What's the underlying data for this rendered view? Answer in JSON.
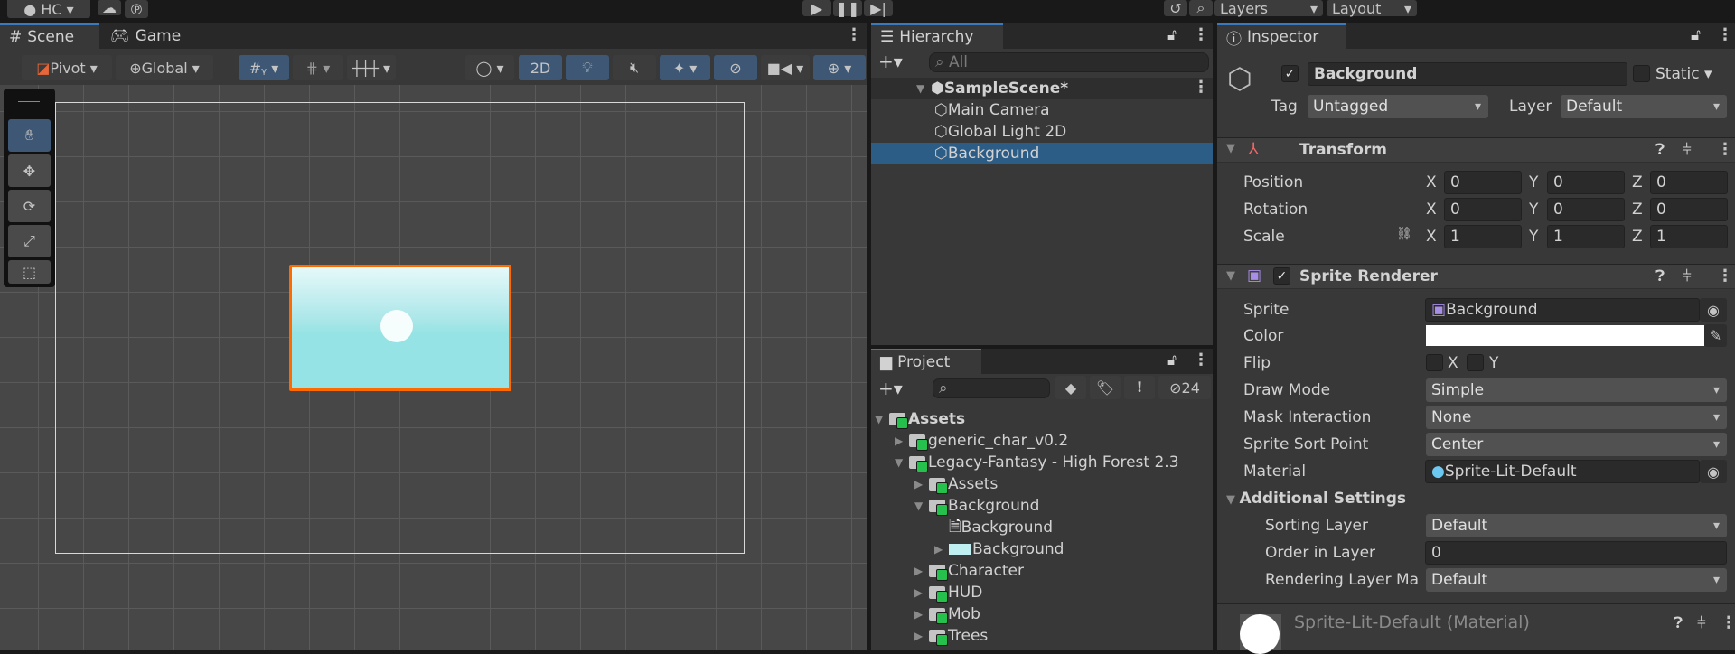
{
  "topbar": {
    "account": "HC",
    "play_icons": [
      "play-icon",
      "pause-icon",
      "step-icon"
    ],
    "layers": "Layers",
    "layout": "Layout"
  },
  "scene": {
    "tabs": [
      {
        "label": "Scene",
        "icon": "grid-icon"
      },
      {
        "label": "Game",
        "icon": "gamepad-icon"
      }
    ],
    "toolbar": {
      "pivot": "Pivot",
      "global": "Global",
      "mode2d": "2D"
    },
    "tools": [
      "hand-tool",
      "move-tool",
      "rotate-tool",
      "scale-tool",
      "rect-tool",
      "transform-tool"
    ],
    "selection_color": "#ff6a00",
    "sprite_color": "#95e3e4"
  },
  "hierarchy": {
    "title": "Hierarchy",
    "search_placeholder": "All",
    "items": [
      {
        "label": "SampleScene*",
        "depth": 0,
        "bold": true,
        "expanded": true
      },
      {
        "label": "Main Camera",
        "depth": 1
      },
      {
        "label": "Global Light 2D",
        "depth": 1
      },
      {
        "label": "Background",
        "depth": 1,
        "selected": true
      }
    ]
  },
  "project": {
    "title": "Project",
    "hidden_count": "24",
    "items": [
      {
        "label": "Assets",
        "depth": 0,
        "bold": true,
        "arrow": "▼",
        "type": "folder-open"
      },
      {
        "label": "generic_char_v0.2",
        "depth": 1,
        "arrow": "▶",
        "type": "folder"
      },
      {
        "label": "Legacy-Fantasy - High Forest 2.3",
        "depth": 1,
        "arrow": "▼",
        "type": "folder-open"
      },
      {
        "label": "Assets",
        "depth": 2,
        "arrow": "▶",
        "type": "folder"
      },
      {
        "label": "Background",
        "depth": 2,
        "arrow": "▼",
        "type": "folder-open"
      },
      {
        "label": "Background",
        "depth": 3,
        "arrow": "",
        "type": "file"
      },
      {
        "label": "Background",
        "depth": 3,
        "arrow": "▶",
        "type": "sprite"
      },
      {
        "label": "Character",
        "depth": 2,
        "arrow": "▶",
        "type": "folder"
      },
      {
        "label": "HUD",
        "depth": 2,
        "arrow": "▶",
        "type": "folder"
      },
      {
        "label": "Mob",
        "depth": 2,
        "arrow": "▶",
        "type": "folder"
      },
      {
        "label": "Trees",
        "depth": 2,
        "arrow": "▶",
        "type": "folder"
      }
    ]
  },
  "inspector": {
    "title": "Inspector",
    "name": "Background",
    "static": "Static",
    "tag_label": "Tag",
    "tag": "Untagged",
    "layer_label": "Layer",
    "layer": "Default",
    "transform": {
      "title": "Transform",
      "rows": [
        {
          "label": "Position",
          "x": "0",
          "y": "0",
          "z": "0"
        },
        {
          "label": "Rotation",
          "x": "0",
          "y": "0",
          "z": "0"
        },
        {
          "label": "Scale",
          "x": "1",
          "y": "1",
          "z": "1"
        }
      ],
      "axes": [
        "X",
        "Y",
        "Z"
      ]
    },
    "sprite_renderer": {
      "title": "Sprite Renderer",
      "sprite_label": "Sprite",
      "sprite": "Background",
      "color_label": "Color",
      "color": "#ffffff",
      "flip_label": "Flip",
      "flip_x": "X",
      "flip_y": "Y",
      "draw_mode_label": "Draw Mode",
      "draw_mode": "Simple",
      "mask_label": "Mask Interaction",
      "mask": "None",
      "sort_point_label": "Sprite Sort Point",
      "sort_point": "Center",
      "material_label": "Material",
      "material": "Sprite-Lit-Default",
      "additional": "Additional Settings",
      "sorting_layer_label": "Sorting Layer",
      "sorting_layer": "Default",
      "order_label": "Order in Layer",
      "order": "0",
      "rendering_label": "Rendering Layer Ma",
      "rendering": "Default"
    },
    "material_section": "Sprite-Lit-Default (Material)"
  }
}
